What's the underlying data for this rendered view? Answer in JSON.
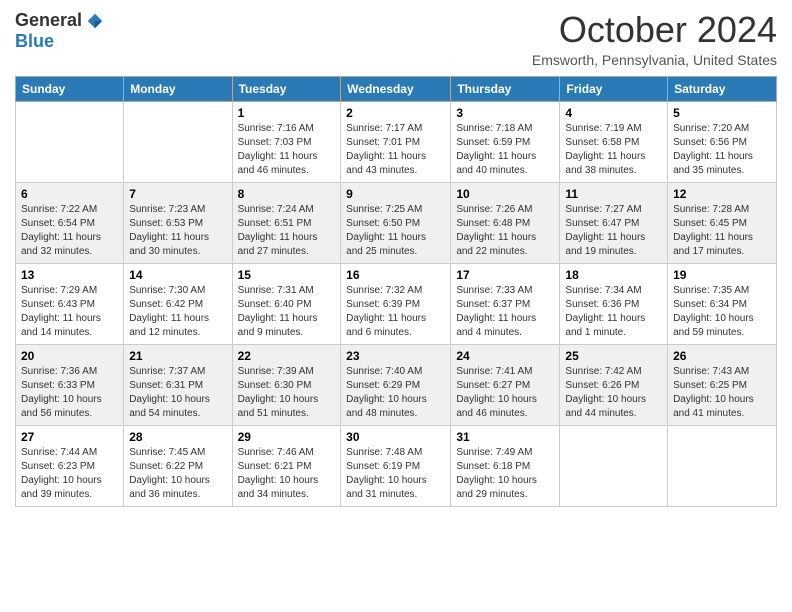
{
  "logo": {
    "general": "General",
    "blue": "Blue"
  },
  "title": "October 2024",
  "location": "Emsworth, Pennsylvania, United States",
  "days_of_week": [
    "Sunday",
    "Monday",
    "Tuesday",
    "Wednesday",
    "Thursday",
    "Friday",
    "Saturday"
  ],
  "weeks": [
    [
      {
        "day": "",
        "info": ""
      },
      {
        "day": "",
        "info": ""
      },
      {
        "day": "1",
        "info": "Sunrise: 7:16 AM\nSunset: 7:03 PM\nDaylight: 11 hours and 46 minutes."
      },
      {
        "day": "2",
        "info": "Sunrise: 7:17 AM\nSunset: 7:01 PM\nDaylight: 11 hours and 43 minutes."
      },
      {
        "day": "3",
        "info": "Sunrise: 7:18 AM\nSunset: 6:59 PM\nDaylight: 11 hours and 40 minutes."
      },
      {
        "day": "4",
        "info": "Sunrise: 7:19 AM\nSunset: 6:58 PM\nDaylight: 11 hours and 38 minutes."
      },
      {
        "day": "5",
        "info": "Sunrise: 7:20 AM\nSunset: 6:56 PM\nDaylight: 11 hours and 35 minutes."
      }
    ],
    [
      {
        "day": "6",
        "info": "Sunrise: 7:22 AM\nSunset: 6:54 PM\nDaylight: 11 hours and 32 minutes."
      },
      {
        "day": "7",
        "info": "Sunrise: 7:23 AM\nSunset: 6:53 PM\nDaylight: 11 hours and 30 minutes."
      },
      {
        "day": "8",
        "info": "Sunrise: 7:24 AM\nSunset: 6:51 PM\nDaylight: 11 hours and 27 minutes."
      },
      {
        "day": "9",
        "info": "Sunrise: 7:25 AM\nSunset: 6:50 PM\nDaylight: 11 hours and 25 minutes."
      },
      {
        "day": "10",
        "info": "Sunrise: 7:26 AM\nSunset: 6:48 PM\nDaylight: 11 hours and 22 minutes."
      },
      {
        "day": "11",
        "info": "Sunrise: 7:27 AM\nSunset: 6:47 PM\nDaylight: 11 hours and 19 minutes."
      },
      {
        "day": "12",
        "info": "Sunrise: 7:28 AM\nSunset: 6:45 PM\nDaylight: 11 hours and 17 minutes."
      }
    ],
    [
      {
        "day": "13",
        "info": "Sunrise: 7:29 AM\nSunset: 6:43 PM\nDaylight: 11 hours and 14 minutes."
      },
      {
        "day": "14",
        "info": "Sunrise: 7:30 AM\nSunset: 6:42 PM\nDaylight: 11 hours and 12 minutes."
      },
      {
        "day": "15",
        "info": "Sunrise: 7:31 AM\nSunset: 6:40 PM\nDaylight: 11 hours and 9 minutes."
      },
      {
        "day": "16",
        "info": "Sunrise: 7:32 AM\nSunset: 6:39 PM\nDaylight: 11 hours and 6 minutes."
      },
      {
        "day": "17",
        "info": "Sunrise: 7:33 AM\nSunset: 6:37 PM\nDaylight: 11 hours and 4 minutes."
      },
      {
        "day": "18",
        "info": "Sunrise: 7:34 AM\nSunset: 6:36 PM\nDaylight: 11 hours and 1 minute."
      },
      {
        "day": "19",
        "info": "Sunrise: 7:35 AM\nSunset: 6:34 PM\nDaylight: 10 hours and 59 minutes."
      }
    ],
    [
      {
        "day": "20",
        "info": "Sunrise: 7:36 AM\nSunset: 6:33 PM\nDaylight: 10 hours and 56 minutes."
      },
      {
        "day": "21",
        "info": "Sunrise: 7:37 AM\nSunset: 6:31 PM\nDaylight: 10 hours and 54 minutes."
      },
      {
        "day": "22",
        "info": "Sunrise: 7:39 AM\nSunset: 6:30 PM\nDaylight: 10 hours and 51 minutes."
      },
      {
        "day": "23",
        "info": "Sunrise: 7:40 AM\nSunset: 6:29 PM\nDaylight: 10 hours and 48 minutes."
      },
      {
        "day": "24",
        "info": "Sunrise: 7:41 AM\nSunset: 6:27 PM\nDaylight: 10 hours and 46 minutes."
      },
      {
        "day": "25",
        "info": "Sunrise: 7:42 AM\nSunset: 6:26 PM\nDaylight: 10 hours and 44 minutes."
      },
      {
        "day": "26",
        "info": "Sunrise: 7:43 AM\nSunset: 6:25 PM\nDaylight: 10 hours and 41 minutes."
      }
    ],
    [
      {
        "day": "27",
        "info": "Sunrise: 7:44 AM\nSunset: 6:23 PM\nDaylight: 10 hours and 39 minutes."
      },
      {
        "day": "28",
        "info": "Sunrise: 7:45 AM\nSunset: 6:22 PM\nDaylight: 10 hours and 36 minutes."
      },
      {
        "day": "29",
        "info": "Sunrise: 7:46 AM\nSunset: 6:21 PM\nDaylight: 10 hours and 34 minutes."
      },
      {
        "day": "30",
        "info": "Sunrise: 7:48 AM\nSunset: 6:19 PM\nDaylight: 10 hours and 31 minutes."
      },
      {
        "day": "31",
        "info": "Sunrise: 7:49 AM\nSunset: 6:18 PM\nDaylight: 10 hours and 29 minutes."
      },
      {
        "day": "",
        "info": ""
      },
      {
        "day": "",
        "info": ""
      }
    ]
  ]
}
